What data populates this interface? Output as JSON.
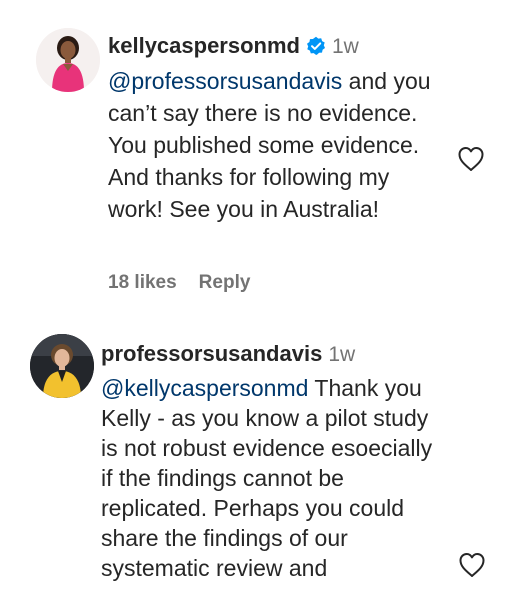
{
  "comments": [
    {
      "username": "kellycaspersonmd",
      "verified": true,
      "time": "1w",
      "mention": "@professorsusandavis",
      "body": " and you can’t say there is no evidence. You published some evidence. And thanks for following my work! See you in Australia!",
      "likes": "18 likes",
      "reply": "Reply",
      "avatar_icon": "avatar-woman-pink-top",
      "like_icon": "heart-outline-icon"
    },
    {
      "username": "professorsusandavis",
      "verified": false,
      "time": "1w",
      "mention": "@kellycaspersonmd",
      "body": " Thank you Kelly - as you know a pilot study is not robust evidence esoecially if the findings cannot be replicated. Perhaps you could share the findings of our systematic review and",
      "avatar_icon": "avatar-woman-yellow-jacket",
      "like_icon": "heart-outline-icon"
    }
  ],
  "colors": {
    "text": "#262626",
    "secondary": "#737373",
    "mention": "#00376b",
    "verified": "#0095f6"
  }
}
